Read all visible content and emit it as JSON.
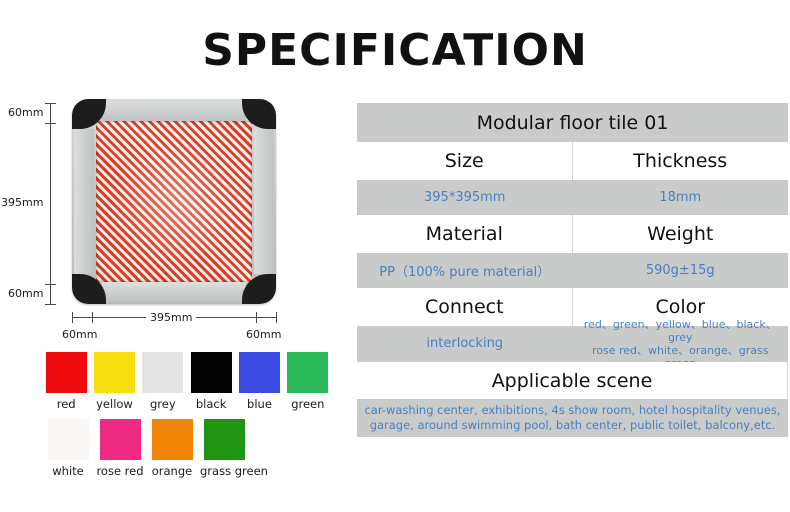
{
  "title": "SPECIFICATION",
  "product": {
    "dimensions": {
      "left_top": "60mm",
      "left_middle": "395mm",
      "left_bottom": "60mm",
      "bottom_left": "60mm",
      "bottom_middle": "395mm",
      "bottom_right": "60mm"
    },
    "image_alt": "modular-floor-tile"
  },
  "swatches": {
    "row1": [
      {
        "label": "red",
        "hex": "#ee0b0b"
      },
      {
        "label": "yellow",
        "hex": "#f8e010"
      },
      {
        "label": "grey",
        "hex": "#e4e4e4"
      },
      {
        "label": "black",
        "hex": "#030303"
      },
      {
        "label": "blue",
        "hex": "#3a49e0"
      },
      {
        "label": "green",
        "hex": "#2bb85a"
      }
    ],
    "row2": [
      {
        "label": "white",
        "hex": "#faf7f4"
      },
      {
        "label": "rose red",
        "hex": "#ee2b82"
      },
      {
        "label": "orange",
        "hex": "#f08407"
      },
      {
        "label": "grass green",
        "hex": "#1f9415"
      }
    ]
  },
  "spec": {
    "header": "Modular floor tile 01",
    "rows": [
      {
        "key_left": "Size",
        "key_right": "Thickness",
        "val_left": "395*395mm",
        "val_right": "18mm"
      },
      {
        "key_left": "Material",
        "key_right": "Weight",
        "val_left": "PP（100% pure material）",
        "val_right": "590g±15g"
      },
      {
        "key_left": "Connect",
        "key_right": "Color",
        "val_left": "interlocking",
        "val_right_line1": "red、green、yellow、blue、black、grey",
        "val_right_line2": "rose red、white、orange、grass green"
      }
    ],
    "scene_title": "Applicable scene",
    "scene_line1": "car-washing center, exhibitions, 4s show room, hotel hospitality venues,",
    "scene_line2": "garage, around swimming pool, bath center, public toilet, balcony,etc."
  },
  "colors": {
    "row_gray": "#c9cbcb",
    "value_blue": "#4b7fbe",
    "text_black": "#111111"
  }
}
